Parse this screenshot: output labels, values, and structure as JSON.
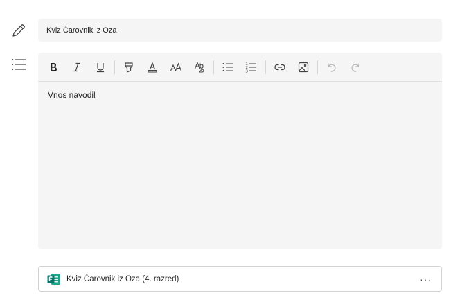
{
  "assignment": {
    "title": "Kviz Čarovnik iz Oza",
    "instructions_placeholder": "Vnos navodil"
  },
  "toolbar": {
    "buttons": [
      {
        "name": "bold",
        "icon": "bold-icon"
      },
      {
        "name": "italic",
        "icon": "italic-icon"
      },
      {
        "name": "underline",
        "icon": "underline-icon"
      },
      {
        "name": "highlight",
        "icon": "highlighter-icon"
      },
      {
        "name": "font-color",
        "icon": "font-color-icon"
      },
      {
        "name": "font-size",
        "icon": "font-size-icon"
      },
      {
        "name": "clear-formatting",
        "icon": "clear-format-icon"
      },
      {
        "name": "bulleted-list",
        "icon": "bullet-list-icon"
      },
      {
        "name": "numbered-list",
        "icon": "numbered-list-icon"
      },
      {
        "name": "link",
        "icon": "link-icon"
      },
      {
        "name": "image",
        "icon": "image-icon"
      },
      {
        "name": "undo",
        "icon": "undo-icon"
      },
      {
        "name": "redo",
        "icon": "redo-icon"
      }
    ]
  },
  "attachment": {
    "label": "Kviz Čarovnik iz Oza (4. razred)",
    "icon": "microsoft-forms-icon",
    "more_label": "···"
  },
  "colors": {
    "field_background": "#f5f5f5",
    "forms_green": "#077568",
    "text": "#242424"
  }
}
